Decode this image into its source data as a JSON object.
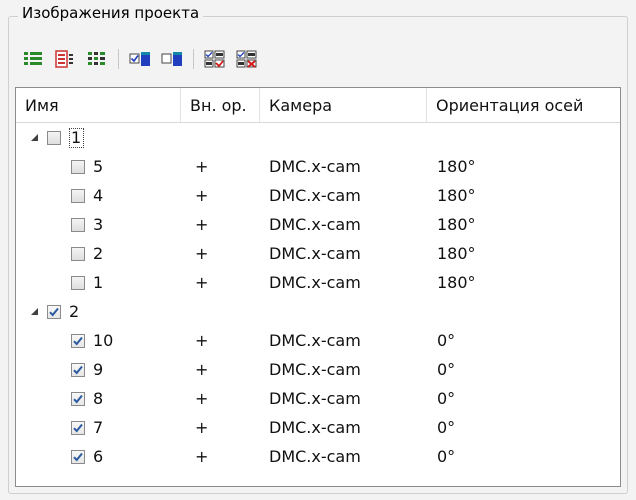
{
  "group": {
    "title": "Изображения проекта"
  },
  "toolbar": {
    "buttons": [
      {
        "icon": "select-all-list-icon"
      },
      {
        "icon": "select-none-list-icon"
      },
      {
        "icon": "invert-list-icon"
      },
      {
        "icon": "check-selected-icon"
      },
      {
        "icon": "uncheck-selected-icon"
      },
      {
        "icon": "check-group-icon"
      },
      {
        "icon": "uncheck-group-icon"
      }
    ]
  },
  "table": {
    "columns": [
      "Имя",
      "Вн. ор.",
      "Камера",
      "Ориентация осей"
    ],
    "groups": [
      {
        "name": "1",
        "checked": false,
        "expanded": true,
        "children": [
          {
            "name": "5",
            "checked": false,
            "inner": "+",
            "camera": "DMC.x-cam",
            "orientation": "180°"
          },
          {
            "name": "4",
            "checked": false,
            "inner": "+",
            "camera": "DMC.x-cam",
            "orientation": "180°"
          },
          {
            "name": "3",
            "checked": false,
            "inner": "+",
            "camera": "DMC.x-cam",
            "orientation": "180°"
          },
          {
            "name": "2",
            "checked": false,
            "inner": "+",
            "camera": "DMC.x-cam",
            "orientation": "180°"
          },
          {
            "name": "1",
            "checked": false,
            "inner": "+",
            "camera": "DMC.x-cam",
            "orientation": "180°"
          }
        ]
      },
      {
        "name": "2",
        "checked": true,
        "expanded": true,
        "children": [
          {
            "name": "10",
            "checked": true,
            "inner": "+",
            "camera": "DMC.x-cam",
            "orientation": "0°"
          },
          {
            "name": "9",
            "checked": true,
            "inner": "+",
            "camera": "DMC.x-cam",
            "orientation": "0°"
          },
          {
            "name": "8",
            "checked": true,
            "inner": "+",
            "camera": "DMC.x-cam",
            "orientation": "0°"
          },
          {
            "name": "7",
            "checked": true,
            "inner": "+",
            "camera": "DMC.x-cam",
            "orientation": "0°"
          },
          {
            "name": "6",
            "checked": true,
            "inner": "+",
            "camera": "DMC.x-cam",
            "orientation": "0°"
          }
        ]
      }
    ]
  },
  "colors": {
    "check": "#2c5aa0",
    "accent_blue": "#1f3fbf",
    "accent_red": "#d11a1a",
    "icon_green": "#2a8a2a"
  }
}
